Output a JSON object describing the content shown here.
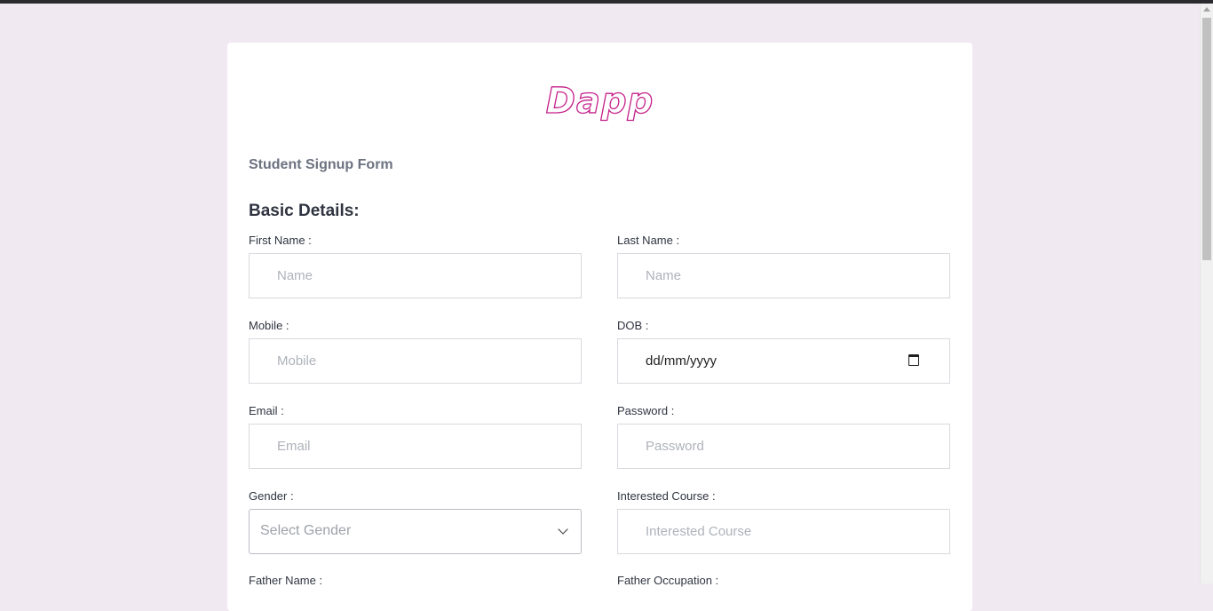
{
  "brand": {
    "logo_text": "Dapp"
  },
  "form": {
    "title": "Student Signup Form",
    "section_title": "Basic Details:",
    "fields": {
      "first_name": {
        "label": "First Name :",
        "placeholder": "Name",
        "value": ""
      },
      "last_name": {
        "label": "Last Name :",
        "placeholder": "Name",
        "value": ""
      },
      "mobile": {
        "label": "Mobile :",
        "placeholder": "Mobile",
        "value": ""
      },
      "dob": {
        "label": "DOB :",
        "display": "dd/mm/yyyy",
        "icon": "calendar-icon"
      },
      "email": {
        "label": "Email :",
        "placeholder": "Email",
        "value": ""
      },
      "password": {
        "label": "Password :",
        "placeholder": "Password",
        "value": ""
      },
      "gender": {
        "label": "Gender :",
        "selected": "Select Gender",
        "icon": "chevron-down-icon"
      },
      "interested_course": {
        "label": "Interested Course :",
        "placeholder": "Interested Course",
        "value": ""
      },
      "father_name": {
        "label": "Father Name :"
      },
      "father_occupation": {
        "label": "Father Occupation :"
      }
    }
  },
  "colors": {
    "page_background": "#f1e9f2",
    "card_background": "#ffffff",
    "logo_stroke": "#c4218a",
    "top_bar": "#2b2b2f"
  }
}
